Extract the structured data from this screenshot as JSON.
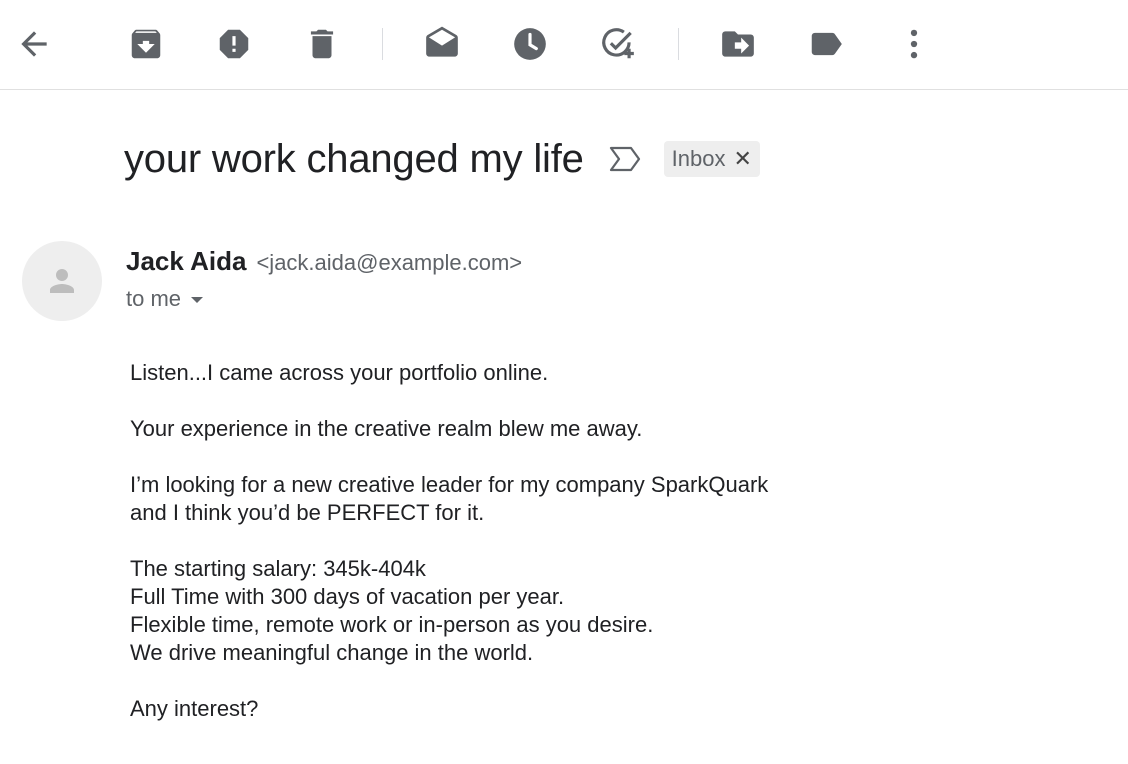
{
  "toolbar": {
    "buttons": [
      {
        "icon": "back-arrow-icon"
      },
      {
        "icon": "archive-icon"
      },
      {
        "icon": "report-spam-icon"
      },
      {
        "icon": "delete-icon"
      },
      {
        "icon": "mark-unread-icon"
      },
      {
        "icon": "snooze-icon"
      },
      {
        "icon": "add-to-tasks-icon"
      },
      {
        "icon": "move-to-icon"
      },
      {
        "icon": "labels-icon"
      },
      {
        "icon": "more-options-icon"
      }
    ],
    "icon_color": "#5f6368"
  },
  "message": {
    "subject": "your work changed my life",
    "label_chip": "Inbox",
    "label_remove": "✕",
    "sender_name": "Jack Aida",
    "sender_email": "<jack.aida@example.com>",
    "recipient": "to me",
    "body": {
      "p1": "Listen...I came across your portfolio online.",
      "p2": "Your experience in the creative realm blew me away.",
      "p3_l1": "I’m looking for a new creative leader for my company SparkQuark",
      "p3_l2": "and I think you’d be PERFECT for it.",
      "p4_l1": "The starting salary: 345k-404k",
      "p4_l2": "Full Time with 300 days of vacation per year.",
      "p4_l3": "Flexible time, remote work or in-person as you desire.",
      "p4_l4": "We drive meaningful change in the world.",
      "p5": "Any interest?"
    }
  }
}
